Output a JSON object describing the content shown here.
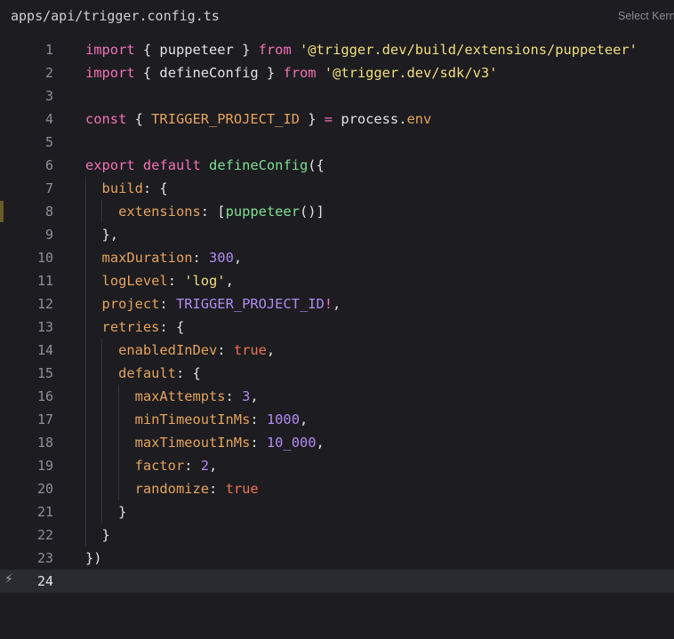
{
  "header": {
    "file_path": "apps/api/trigger.config.ts",
    "kernel_select": "Select Kernel"
  },
  "editor": {
    "current_line": 24,
    "lines": [
      {
        "n": "1",
        "tokens": [
          [
            "kw",
            "import"
          ],
          [
            "punc",
            " { "
          ],
          [
            "plain",
            "puppeteer"
          ],
          [
            "punc",
            " } "
          ],
          [
            "kw",
            "from"
          ],
          [
            "punc",
            " "
          ],
          [
            "str",
            "'@trigger.dev/build/extensions/puppeteer'"
          ]
        ]
      },
      {
        "n": "2",
        "tokens": [
          [
            "kw",
            "import"
          ],
          [
            "punc",
            " { "
          ],
          [
            "plain",
            "defineConfig"
          ],
          [
            "punc",
            " } "
          ],
          [
            "kw",
            "from"
          ],
          [
            "punc",
            " "
          ],
          [
            "str",
            "'@trigger.dev/sdk/v3'"
          ]
        ]
      },
      {
        "n": "3",
        "tokens": []
      },
      {
        "n": "4",
        "tokens": [
          [
            "kw",
            "const"
          ],
          [
            "punc",
            " { "
          ],
          [
            "const",
            "TRIGGER_PROJECT_ID"
          ],
          [
            "punc",
            " } "
          ],
          [
            "op",
            "="
          ],
          [
            "punc",
            " "
          ],
          [
            "plain",
            "process"
          ],
          [
            "punc",
            "."
          ],
          [
            "prop",
            "env"
          ]
        ]
      },
      {
        "n": "5",
        "tokens": []
      },
      {
        "n": "6",
        "tokens": [
          [
            "kw",
            "export"
          ],
          [
            "punc",
            " "
          ],
          [
            "kw",
            "default"
          ],
          [
            "punc",
            " "
          ],
          [
            "fn",
            "defineConfig"
          ],
          [
            "punc",
            "({"
          ]
        ]
      },
      {
        "n": "7",
        "tokens": [
          [
            "punc",
            "  "
          ],
          [
            "prop",
            "build"
          ],
          [
            "punc",
            ": {"
          ]
        ]
      },
      {
        "n": "8",
        "tokens": [
          [
            "punc",
            "    "
          ],
          [
            "prop",
            "extensions"
          ],
          [
            "punc",
            ": ["
          ],
          [
            "fn",
            "puppeteer"
          ],
          [
            "punc",
            "()]"
          ]
        ]
      },
      {
        "n": "9",
        "tokens": [
          [
            "punc",
            "  },"
          ]
        ]
      },
      {
        "n": "10",
        "tokens": [
          [
            "punc",
            "  "
          ],
          [
            "prop",
            "maxDuration"
          ],
          [
            "punc",
            ": "
          ],
          [
            "num",
            "300"
          ],
          [
            "punc",
            ","
          ]
        ]
      },
      {
        "n": "11",
        "tokens": [
          [
            "punc",
            "  "
          ],
          [
            "prop",
            "logLevel"
          ],
          [
            "punc",
            ": "
          ],
          [
            "str",
            "'log'"
          ],
          [
            "punc",
            ","
          ]
        ]
      },
      {
        "n": "12",
        "tokens": [
          [
            "punc",
            "  "
          ],
          [
            "prop",
            "project"
          ],
          [
            "punc",
            ": "
          ],
          [
            "ident",
            "TRIGGER_PROJECT_ID"
          ],
          [
            "op",
            "!"
          ],
          [
            "punc",
            ","
          ]
        ]
      },
      {
        "n": "13",
        "tokens": [
          [
            "punc",
            "  "
          ],
          [
            "prop",
            "retries"
          ],
          [
            "punc",
            ": {"
          ]
        ]
      },
      {
        "n": "14",
        "tokens": [
          [
            "punc",
            "    "
          ],
          [
            "prop",
            "enabledInDev"
          ],
          [
            "punc",
            ": "
          ],
          [
            "bool",
            "true"
          ],
          [
            "punc",
            ","
          ]
        ]
      },
      {
        "n": "15",
        "tokens": [
          [
            "punc",
            "    "
          ],
          [
            "prop",
            "default"
          ],
          [
            "punc",
            ": {"
          ]
        ]
      },
      {
        "n": "16",
        "tokens": [
          [
            "punc",
            "      "
          ],
          [
            "prop",
            "maxAttempts"
          ],
          [
            "punc",
            ": "
          ],
          [
            "num",
            "3"
          ],
          [
            "punc",
            ","
          ]
        ]
      },
      {
        "n": "17",
        "tokens": [
          [
            "punc",
            "      "
          ],
          [
            "prop",
            "minTimeoutInMs"
          ],
          [
            "punc",
            ": "
          ],
          [
            "num",
            "1000"
          ],
          [
            "punc",
            ","
          ]
        ]
      },
      {
        "n": "18",
        "tokens": [
          [
            "punc",
            "      "
          ],
          [
            "prop",
            "maxTimeoutInMs"
          ],
          [
            "punc",
            ": "
          ],
          [
            "num",
            "10_000"
          ],
          [
            "punc",
            ","
          ]
        ]
      },
      {
        "n": "19",
        "tokens": [
          [
            "punc",
            "      "
          ],
          [
            "prop",
            "factor"
          ],
          [
            "punc",
            ": "
          ],
          [
            "num",
            "2"
          ],
          [
            "punc",
            ","
          ]
        ]
      },
      {
        "n": "20",
        "tokens": [
          [
            "punc",
            "      "
          ],
          [
            "prop",
            "randomize"
          ],
          [
            "punc",
            ": "
          ],
          [
            "bool",
            "true"
          ]
        ]
      },
      {
        "n": "21",
        "tokens": [
          [
            "punc",
            "    }"
          ]
        ]
      },
      {
        "n": "22",
        "tokens": [
          [
            "punc",
            "  }"
          ]
        ]
      },
      {
        "n": "23",
        "tokens": [
          [
            "punc",
            "})"
          ]
        ]
      },
      {
        "n": "24",
        "tokens": []
      }
    ],
    "modified_line": 8,
    "current_line_icon": "lightning-icon",
    "current_line_glyph": "⚡"
  }
}
